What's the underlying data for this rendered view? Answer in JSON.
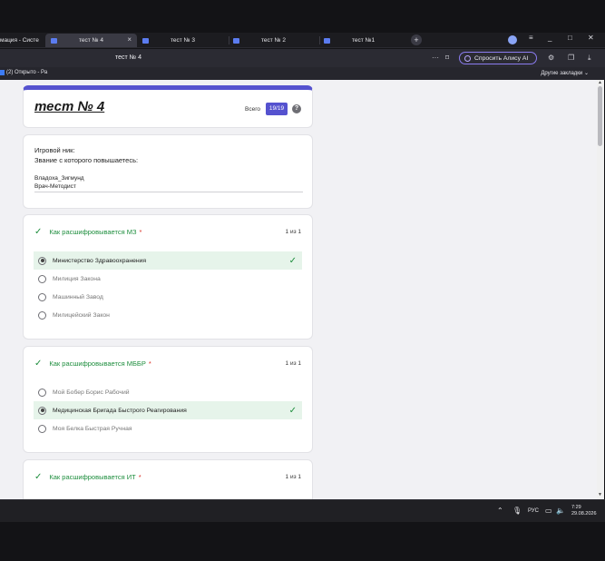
{
  "browser": {
    "tabs": [
      {
        "label": "мация - Систе"
      },
      {
        "label": "тест № 4",
        "active": true
      },
      {
        "label": "тест № 3"
      },
      {
        "label": "тест № 2"
      },
      {
        "label": "тест №1"
      }
    ],
    "address_title": "тест № 4",
    "alice_button": "Спросить Алису AI",
    "bookmark_item": "(2) Открыто - Ра",
    "other_bookmarks": "Другие закладки"
  },
  "form": {
    "title": "тест № 4",
    "total_label": "Всего",
    "score": "19/19",
    "help": "?",
    "nick_label": "Игровой ник:",
    "rank_label": "Звание с которого повышаетесь:",
    "nick_value": "Владоха_Зигмунд",
    "rank_value": "Врач-Методист"
  },
  "questions": [
    {
      "title": "Как расшифровывается МЗ",
      "score": "1 из 1",
      "options": [
        {
          "label": "Министерство Здравоохранения",
          "selected": true,
          "correct": true
        },
        {
          "label": "Милиция Закона"
        },
        {
          "label": "Машинный Завод"
        },
        {
          "label": "Милицейский Закон"
        }
      ]
    },
    {
      "title": "Как расшифровывается МББР",
      "score": "1 из 1",
      "options": [
        {
          "label": "Мой Бобер Борис Рабочий"
        },
        {
          "label": "Медицинская Бригада Быстрого Реагирования",
          "selected": true,
          "correct": true
        },
        {
          "label": "Моя Белка Быстрая Ручная"
        }
      ]
    },
    {
      "title": "Как расшифровывается ИТ",
      "score": "1 из 1",
      "options": []
    }
  ],
  "taskbar": {
    "lang": "РУС",
    "time": "7:29",
    "date": "29.08.2026"
  },
  "colors": {
    "accent": "#5552cf",
    "correct_green": "#1e8e3e",
    "correct_bg": "#e6f4ea",
    "required_red": "#d93025"
  }
}
